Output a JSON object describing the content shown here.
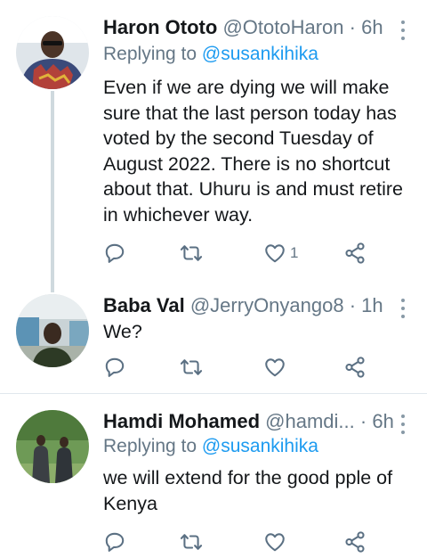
{
  "colors": {
    "link": "#1d9bf0",
    "muted": "#657786",
    "icon": "#5b7083",
    "divider": "#e1e8ed",
    "thread": "#cfd9de"
  },
  "tweets": [
    {
      "name": "Haron Ototo",
      "handle": "@OtotoHaron",
      "dot": "·",
      "time": "6h",
      "replying_prefix": "Replying to",
      "replying_to": "@susankihika",
      "text": "Even if we are dying we will make sure that the last person today has voted by the second Tuesday of August 2022. There is no shortcut about that. Uhuru is and must retire in whichever way.",
      "likes": "1",
      "icons": [
        "reply-icon",
        "retweet-icon",
        "like-icon",
        "share-icon"
      ]
    },
    {
      "name": "Baba Val",
      "handle": "@JerryOnyango8",
      "dot": "·",
      "time": "1h",
      "text": "We?",
      "icons": [
        "reply-icon",
        "retweet-icon",
        "like-icon",
        "share-icon"
      ]
    },
    {
      "name": "Hamdi Mohamed",
      "handle": "@hamdi...",
      "dot": "·",
      "time": "6h",
      "replying_prefix": "Replying to",
      "replying_to": "@susankihika",
      "text": "we will extend for the good pple of Kenya",
      "icons": [
        "reply-icon",
        "retweet-icon",
        "like-icon",
        "share-icon"
      ]
    }
  ]
}
